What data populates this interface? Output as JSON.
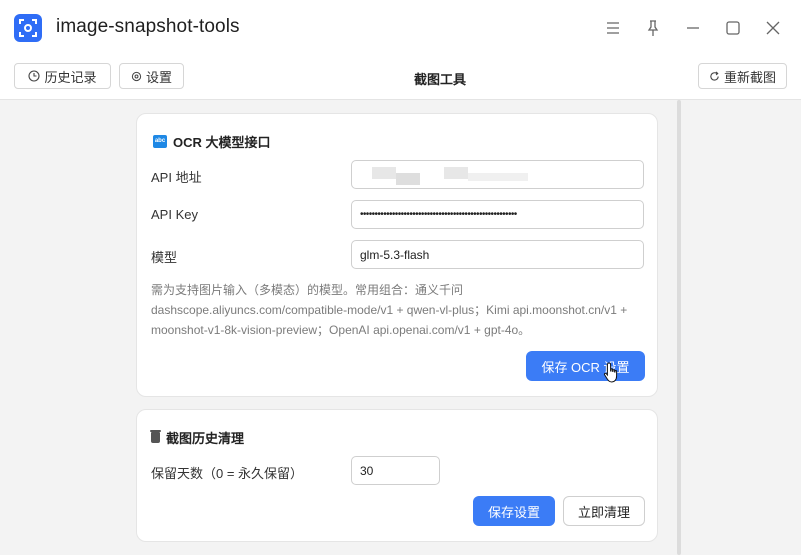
{
  "window": {
    "title": "image-snapshot-tools",
    "accent_color": "#3b7cf6"
  },
  "toolbar": {
    "history_label": "历史记录",
    "settings_label": "设置",
    "title": "截图工具",
    "recapture_label": "重新截图"
  },
  "ocr_card": {
    "icon_text": "abc",
    "title": "OCR 大模型接口",
    "fields": [
      {
        "label": "API 地址",
        "value": ""
      },
      {
        "label": "API Key",
        "value": "••••••••••••••••••••••••••••••••••••••••••••••••••••••"
      },
      {
        "label": "模型",
        "value": "glm-5.3-flash"
      }
    ],
    "hint": "需为支持图片输入（多模态）的模型。常用组合：通义千问 dashscope.aliyuncs.com/compatible-mode/v1 + qwen-vl-plus；Kimi api.moonshot.cn/v1 + moonshot-v1-8k-vision-preview；OpenAI api.openai.com/v1 + gpt-4o。",
    "save_label": "保存 OCR 设置"
  },
  "history_card": {
    "title": "截图历史清理",
    "retention_label": "保留天数（0 = 永久保留）",
    "retention_value": "30",
    "save_label": "保存设置",
    "clean_label": "立即清理"
  }
}
